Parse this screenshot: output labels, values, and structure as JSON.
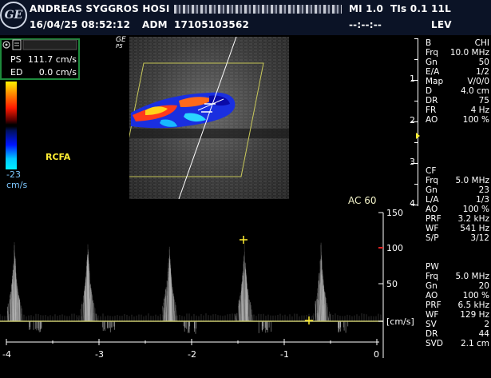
{
  "header": {
    "hospital": "ANDREAS SYGGROS HOSI",
    "date_time": "16/04/25 08:52:12",
    "operator": "ADM",
    "patient_id": "17105103562",
    "mi": "MI 1.0",
    "tis": "TIs 0.1",
    "probe": "11L",
    "dashes": "--:--:--",
    "preset": "LEV",
    "logo_text": "GE"
  },
  "measurements": {
    "ps_label": "PS",
    "ps_value": "111.7 cm/s",
    "ed_label": "ED",
    "ed_value": "0.0 cm/s"
  },
  "colorbar": {
    "bottom_label": "-23",
    "unit": "cm/s"
  },
  "image": {
    "ge_mark": "GE",
    "p5": "P5",
    "vessel_label": "RCFA"
  },
  "bmode_params": [
    {
      "k": "B",
      "v": "CHI"
    },
    {
      "k": "Frq",
      "v": "10.0 MHz"
    },
    {
      "k": "Gn",
      "v": "50"
    },
    {
      "k": "E/A",
      "v": "1/2"
    },
    {
      "k": "Map",
      "v": "V/0/0"
    },
    {
      "k": "D",
      "v": "4.0 cm"
    },
    {
      "k": "DR",
      "v": "75"
    },
    {
      "k": "FR",
      "v": "4 Hz"
    },
    {
      "k": "AO",
      "v": "100 %"
    }
  ],
  "cf_params": [
    {
      "k": "CF",
      "v": ""
    },
    {
      "k": "Frq",
      "v": "5.0 MHz"
    },
    {
      "k": "Gn",
      "v": "23"
    },
    {
      "k": "L/A",
      "v": "1/3"
    },
    {
      "k": "AO",
      "v": "100 %"
    },
    {
      "k": "PRF",
      "v": "3.2 kHz"
    },
    {
      "k": "WF",
      "v": "541 Hz"
    },
    {
      "k": "S/P",
      "v": "3/12"
    }
  ],
  "pw_params": [
    {
      "k": "PW",
      "v": ""
    },
    {
      "k": "Frq",
      "v": "5.0 MHz"
    },
    {
      "k": "Gn",
      "v": "20"
    },
    {
      "k": "AO",
      "v": "100 %"
    },
    {
      "k": "PRF",
      "v": "6.5 kHz"
    },
    {
      "k": "WF",
      "v": "129 Hz"
    },
    {
      "k": "SV",
      "v": "2"
    },
    {
      "k": "DR",
      "v": "44"
    },
    {
      "k": "SVD",
      "v": "2.1 cm"
    }
  ],
  "depth_scale": [
    "1",
    "2",
    "3",
    "4"
  ],
  "spectral": {
    "ac_label": "AC 60",
    "velocity_ticks": [
      "150",
      "100",
      "50"
    ],
    "unit_label": "[cm/s]",
    "time_ticks": [
      "-4",
      "-3",
      "-2",
      "-1",
      "0"
    ]
  }
}
